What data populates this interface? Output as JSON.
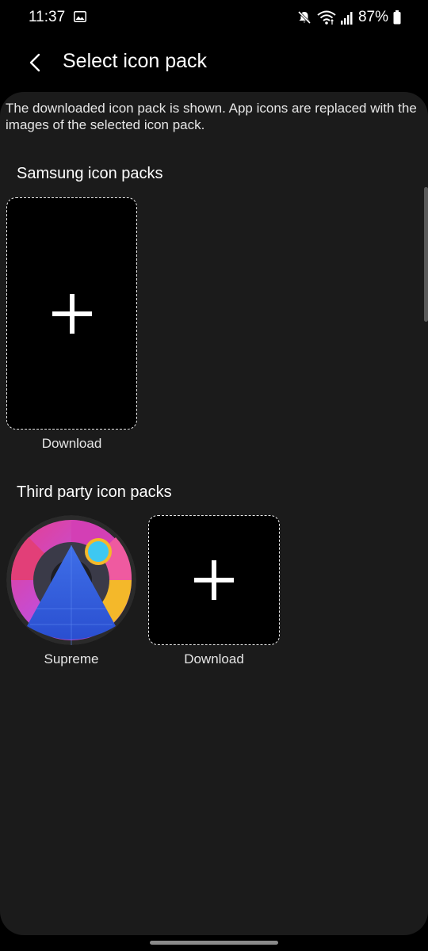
{
  "status_bar": {
    "time": "11:37",
    "battery": "87%",
    "icons": [
      "gallery-icon",
      "mute-icon",
      "wifi-icon",
      "signal-icon",
      "battery-icon"
    ]
  },
  "app_bar": {
    "title": "Select icon pack",
    "back_icon": "chevron-left-icon"
  },
  "description": "The downloaded icon pack is shown. App icons are replaced with the images of the selected icon pack.",
  "samsung_section": {
    "title": "Samsung icon packs",
    "items": [
      {
        "label": "Download",
        "icon": "plus-icon"
      }
    ]
  },
  "third_party_section": {
    "title": "Third party icon packs",
    "items": [
      {
        "label": "Supreme",
        "icon": "supreme-icon-pack"
      },
      {
        "label": "Download",
        "icon": "plus-icon"
      }
    ]
  },
  "colors": {
    "background": "#000000",
    "card": "#1b1b1b",
    "text": "#ffffff"
  }
}
